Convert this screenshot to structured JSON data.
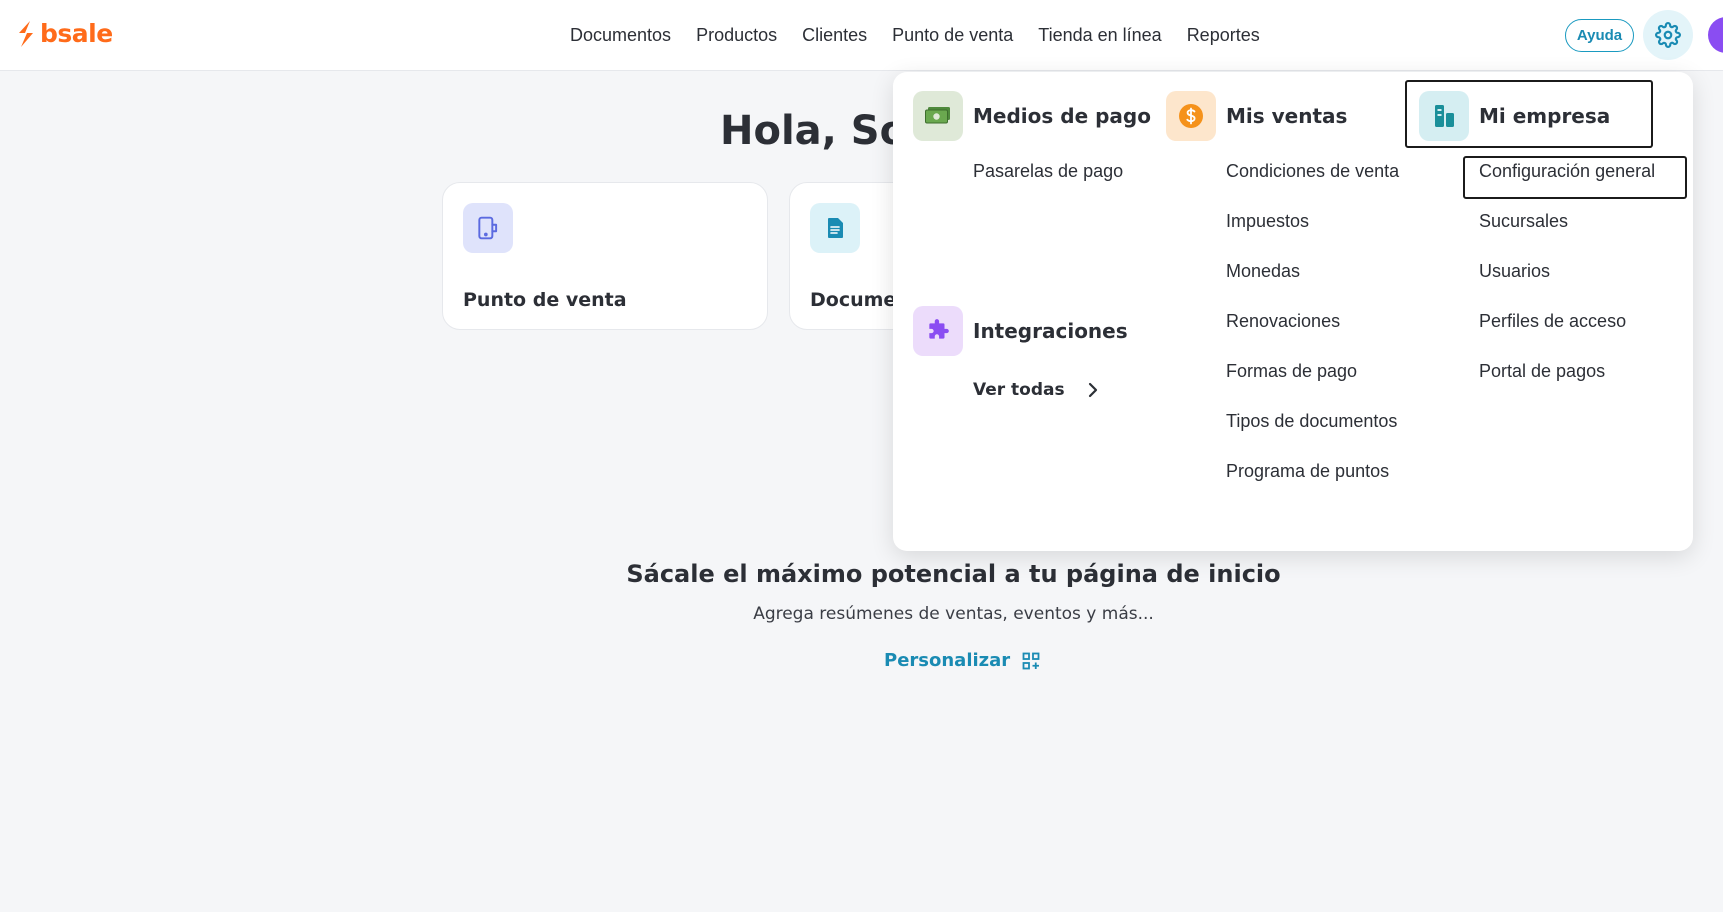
{
  "brand": {
    "name": "bsale",
    "color": "#ff6b1a"
  },
  "nav": [
    "Documentos",
    "Productos",
    "Clientes",
    "Punto de venta",
    "Tienda en línea",
    "Reportes"
  ],
  "header": {
    "help_label": "Ayuda",
    "settings_icon": "gear-icon"
  },
  "greeting": "Hola, Sop",
  "cards": [
    {
      "label": "Punto de venta",
      "icon": "pos-terminal-icon"
    },
    {
      "label": "Docume",
      "icon": "document-icon"
    }
  ],
  "promo": {
    "title": "Sácale el máximo potencial a tu página de inicio",
    "subtitle": "Agrega resúmenes de ventas, eventos y más...",
    "action": "Personalizar"
  },
  "menu": {
    "payments": {
      "title": "Medios de pago",
      "items": [
        "Pasarelas de pago"
      ]
    },
    "integrations": {
      "title": "Integraciones",
      "action": "Ver todas"
    },
    "sales": {
      "title": "Mis ventas",
      "items": [
        "Condiciones de venta",
        "Impuestos",
        "Monedas",
        "Renovaciones",
        "Formas de pago",
        "Tipos de documentos",
        "Programa de puntos"
      ]
    },
    "company": {
      "title": "Mi empresa",
      "items": [
        "Configuración general",
        "Sucursales",
        "Usuarios",
        "Perfiles de acceso",
        "Portal de pagos"
      ]
    }
  },
  "colors": {
    "accent": "#1a8bb3",
    "text": "#2c2f36",
    "avatar": "#8a4df2"
  }
}
